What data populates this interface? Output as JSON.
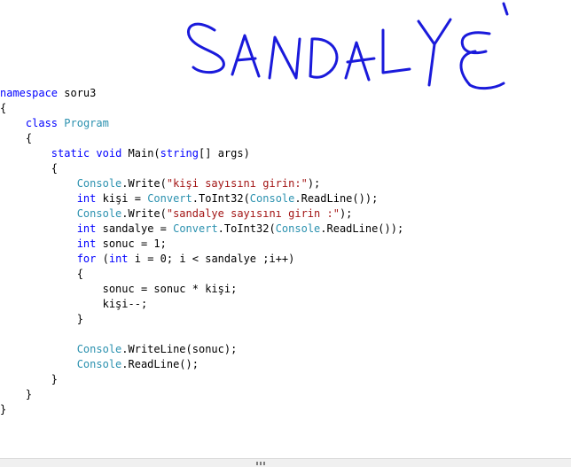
{
  "code": {
    "lines": [
      {
        "indent": "",
        "tokens": [
          {
            "t": "namespace",
            "c": "kw"
          },
          {
            "t": " soru3",
            "c": "plain"
          }
        ]
      },
      {
        "indent": "",
        "tokens": [
          {
            "t": "{",
            "c": "plain"
          }
        ]
      },
      {
        "indent": "    ",
        "tokens": [
          {
            "t": "class",
            "c": "kw"
          },
          {
            "t": " ",
            "c": "plain"
          },
          {
            "t": "Program",
            "c": "type"
          }
        ]
      },
      {
        "indent": "    ",
        "tokens": [
          {
            "t": "{",
            "c": "plain"
          }
        ]
      },
      {
        "indent": "        ",
        "tokens": [
          {
            "t": "static",
            "c": "kw"
          },
          {
            "t": " ",
            "c": "plain"
          },
          {
            "t": "void",
            "c": "kw"
          },
          {
            "t": " Main(",
            "c": "plain"
          },
          {
            "t": "string",
            "c": "kw"
          },
          {
            "t": "[] args)",
            "c": "plain"
          }
        ]
      },
      {
        "indent": "        ",
        "tokens": [
          {
            "t": "{",
            "c": "plain"
          }
        ]
      },
      {
        "indent": "            ",
        "tokens": [
          {
            "t": "Console",
            "c": "type"
          },
          {
            "t": ".Write(",
            "c": "plain"
          },
          {
            "t": "\"kişi sayısını girin:\"",
            "c": "str"
          },
          {
            "t": ");",
            "c": "plain"
          }
        ]
      },
      {
        "indent": "            ",
        "tokens": [
          {
            "t": "int",
            "c": "kw"
          },
          {
            "t": " kişi = ",
            "c": "plain"
          },
          {
            "t": "Convert",
            "c": "type"
          },
          {
            "t": ".ToInt32(",
            "c": "plain"
          },
          {
            "t": "Console",
            "c": "type"
          },
          {
            "t": ".ReadLine());",
            "c": "plain"
          }
        ]
      },
      {
        "indent": "            ",
        "tokens": [
          {
            "t": "Console",
            "c": "type"
          },
          {
            "t": ".Write(",
            "c": "plain"
          },
          {
            "t": "\"sandalye sayısını girin :\"",
            "c": "str"
          },
          {
            "t": ");",
            "c": "plain"
          }
        ]
      },
      {
        "indent": "            ",
        "tokens": [
          {
            "t": "int",
            "c": "kw"
          },
          {
            "t": " sandalye = ",
            "c": "plain"
          },
          {
            "t": "Convert",
            "c": "type"
          },
          {
            "t": ".ToInt32(",
            "c": "plain"
          },
          {
            "t": "Console",
            "c": "type"
          },
          {
            "t": ".ReadLine());",
            "c": "plain"
          }
        ]
      },
      {
        "indent": "            ",
        "tokens": [
          {
            "t": "int",
            "c": "kw"
          },
          {
            "t": " sonuc = 1;",
            "c": "plain"
          }
        ]
      },
      {
        "indent": "            ",
        "tokens": [
          {
            "t": "for",
            "c": "kw"
          },
          {
            "t": " (",
            "c": "plain"
          },
          {
            "t": "int",
            "c": "kw"
          },
          {
            "t": " i = 0; i < sandalye ;i++)",
            "c": "plain"
          }
        ]
      },
      {
        "indent": "            ",
        "tokens": [
          {
            "t": "{",
            "c": "plain"
          }
        ]
      },
      {
        "indent": "                ",
        "tokens": [
          {
            "t": "sonuc = sonuc * kişi;",
            "c": "plain"
          }
        ]
      },
      {
        "indent": "                ",
        "tokens": [
          {
            "t": "kişi--;",
            "c": "plain"
          }
        ]
      },
      {
        "indent": "            ",
        "tokens": [
          {
            "t": "}",
            "c": "plain"
          }
        ]
      },
      {
        "indent": "",
        "tokens": []
      },
      {
        "indent": "            ",
        "tokens": [
          {
            "t": "Console",
            "c": "type"
          },
          {
            "t": ".WriteLine(sonuc);",
            "c": "plain"
          }
        ]
      },
      {
        "indent": "            ",
        "tokens": [
          {
            "t": "Console",
            "c": "type"
          },
          {
            "t": ".ReadLine();",
            "c": "plain"
          }
        ]
      },
      {
        "indent": "        ",
        "tokens": [
          {
            "t": "}",
            "c": "plain"
          }
        ]
      },
      {
        "indent": "    ",
        "tokens": [
          {
            "t": "}",
            "c": "plain"
          }
        ]
      },
      {
        "indent": "",
        "tokens": [
          {
            "t": "}",
            "c": "plain"
          }
        ]
      }
    ]
  },
  "handwriting": {
    "text": "SANDALYE",
    "ink_color": "#1a1adb"
  },
  "colors": {
    "keyword": "#0000ff",
    "type": "#2b91af",
    "string": "#a31515",
    "plain": "#000000",
    "background": "#ffffff"
  },
  "scrollbar": {
    "grip_icon": "grip-dots-icon"
  }
}
